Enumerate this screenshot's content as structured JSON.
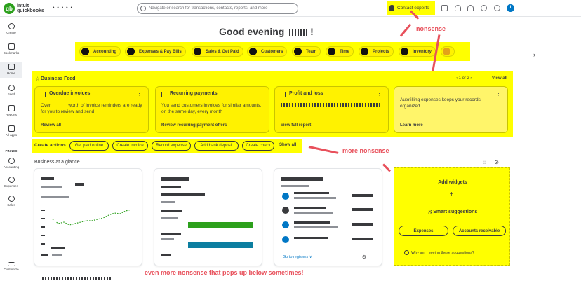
{
  "topbar": {
    "logo_mark": "qb",
    "logo_line1": "intuit",
    "logo_line2": "quickbooks",
    "company_name": "• • • • •",
    "search_placeholder": "Navigate or search for transactions, contacts, reports, and more",
    "contact_label": "Contact experts",
    "info_label": "i"
  },
  "sidebar": {
    "items": [
      {
        "label": "Create"
      },
      {
        "label": "Bookmarks"
      },
      {
        "label": "Home"
      },
      {
        "label": "Feed"
      },
      {
        "label": "Reports"
      },
      {
        "label": "All apps"
      }
    ],
    "pinned_label": "PINNED",
    "pinned": [
      {
        "label": "Accounting"
      },
      {
        "label": "Expenses"
      },
      {
        "label": "Sales"
      }
    ],
    "customize_label": "Customize"
  },
  "greeting": "Good evening",
  "categories": [
    {
      "label": "Accounting"
    },
    {
      "label": "Expenses & Pay Bills"
    },
    {
      "label": "Sales & Get Paid"
    },
    {
      "label": "Customers"
    },
    {
      "label": "Team"
    },
    {
      "label": "Time"
    },
    {
      "label": "Projects"
    },
    {
      "label": "Inventory"
    }
  ],
  "feed": {
    "title": "Business Feed",
    "pager": "1 of 2",
    "view_all": "View all",
    "cards": [
      {
        "title": "Overdue invoices",
        "body": "Over              worth of invoice reminders are ready for you to review and send",
        "link": "Review all"
      },
      {
        "title": "Recurring payments",
        "body": "You send customers invoices for similar amounts, on the same day, every month",
        "link": "Review recurring payment offers"
      },
      {
        "title": "Profit and loss",
        "body": "",
        "link": "View full report"
      },
      {
        "title": "",
        "body": "Autofilling expenses keeps your records organized",
        "link": "Learn more"
      }
    ]
  },
  "actions": {
    "label": "Create actions",
    "items": [
      "Get paid online",
      "Create invoice",
      "Record expense",
      "Add bank deposit",
      "Create check"
    ],
    "view_all": "Show all"
  },
  "glance": {
    "title": "Business at a glance",
    "registers_link": "Go to registers ∨"
  },
  "widgets": {
    "title": "Add widgets",
    "smart_title": "Smart suggestions",
    "suggestions": [
      "Expenses",
      "Accounts receivable"
    ],
    "why": "Why am I seeing these suggestions?"
  },
  "annotations": {
    "nonsense": "nonsense",
    "more_nonsense": "more nonsense",
    "even_more": "even more nonsense that pops up below sometimes!"
  },
  "colors": {
    "highlight": "#ffff00",
    "annotation": "#e8505b",
    "brand_green": "#2ca01c",
    "link_blue": "#0077c5"
  }
}
